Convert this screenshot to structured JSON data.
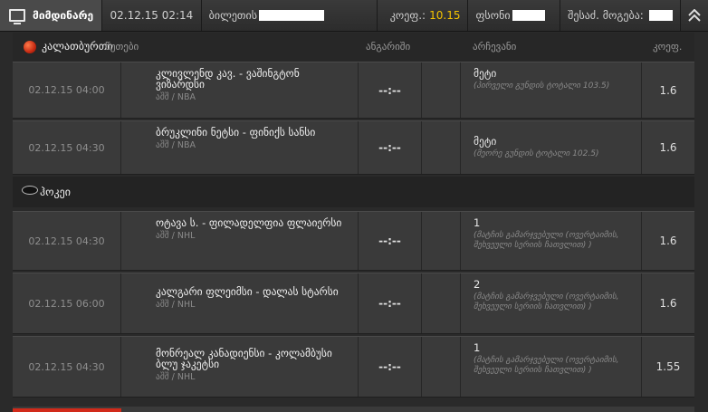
{
  "header": {
    "tab_label": "მიმდინარე",
    "date": "02.12.15 02:14",
    "ticket_label": "ბილეთის",
    "odds_label": "კოეფ.:",
    "odds_value": "10.15",
    "balance_label": "ფსონი",
    "win_label": "შესაძ. მოგება:"
  },
  "columns": {
    "sport": "კალათბურთი",
    "sport2": "ჰოკეი",
    "time": "წუთები",
    "score": "ანგარიში",
    "selection": "არჩევანი",
    "odds": "კოეფ."
  },
  "events": [
    {
      "date": "02.12.15 04:00",
      "name": "კლივლენდ კავ. - ვაშინგტონ ვიზარდსი",
      "league": "აშშ / NBA",
      "score": "--:--",
      "sel": "მეტი",
      "sel_sub": "(პირველი გუნდის ტოტალი 103.5)",
      "odds": "1.6"
    },
    {
      "date": "02.12.15 04:30",
      "name": "ბრუკლინი ნეტსი - ფინიქს სანსი",
      "league": "აშშ / NBA",
      "score": "--:--",
      "sel": "მეტი",
      "sel_sub": "(მეორე გუნდის ტოტალი 102.5)",
      "odds": "1.6"
    },
    {
      "date": "02.12.15 04:30",
      "name": "ოტავა ს. - ფილადელფია ფლაიერსი",
      "league": "აშშ / NHL",
      "score": "--:--",
      "sel": "1",
      "sel_sub": "(მატჩის გამარჯვებული (ოვერტაიმის, შეხვეული სერიის ჩათვლით) )",
      "odds": "1.6"
    },
    {
      "date": "02.12.15 06:00",
      "name": "კალგარი ფლეიმსი - დალას სტარსი",
      "league": "აშშ / NHL",
      "score": "--:--",
      "sel": "2",
      "sel_sub": "(მატჩის გამარჯვებული (ოვერტაიმის, შეხვეული სერიის ჩათვლით) )",
      "odds": "1.6"
    },
    {
      "date": "02.12.15 04:30",
      "name": "მონრეალ კანადიენსი - კოლამბუსი ბლუ ჯაკეტსი",
      "league": "აშშ / NHL",
      "score": "--:--",
      "sel": "1",
      "sel_sub": "(მატჩის გამარჯვებული (ოვერტაიმის, შეხვეული სერიის ჩათვლით) )",
      "odds": "1.55"
    }
  ]
}
